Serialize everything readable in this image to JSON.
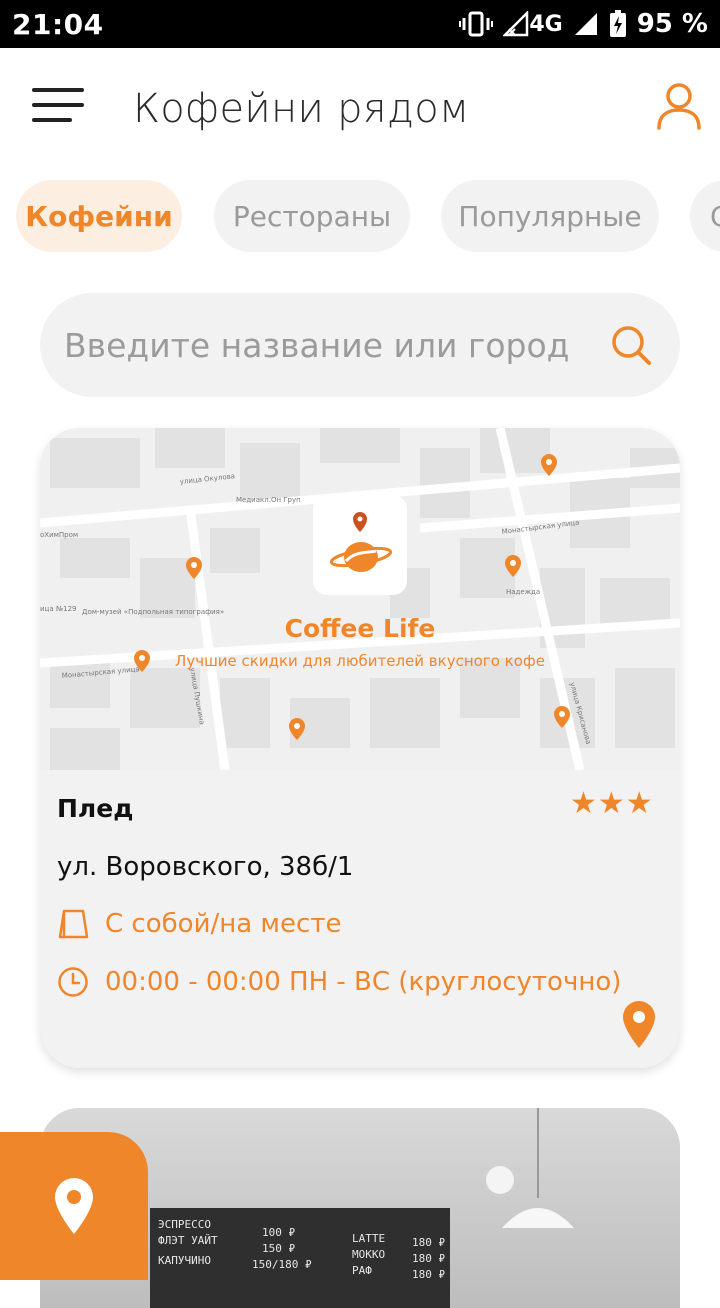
{
  "status_bar": {
    "time": "21:04",
    "network": "4G",
    "battery": "95 %"
  },
  "header": {
    "title": "Кофейни рядом",
    "menu_icon": "hamburger-icon",
    "profile_icon": "user-icon"
  },
  "categories": [
    {
      "label": "Кофейни",
      "active": true
    },
    {
      "label": "Рестораны",
      "active": false
    },
    {
      "label": "Популярные",
      "active": false
    },
    {
      "label": "С",
      "active": false
    }
  ],
  "search": {
    "placeholder": "Введите название или город",
    "value": ""
  },
  "cards": [
    {
      "brand_title": "Coffee Life",
      "brand_subtitle": "Лучшие скидки для любителей вкусного кофе",
      "map_labels": [
        "улица Окулова",
        "Медиакл.Он Груп",
        "оХимПром",
        "Монастырская улица",
        "Надежда",
        "Дом-музей «Подпольная типография»",
        "ица №129",
        "Монастырская улица",
        "улица Пушкина",
        "улица Крисанова"
      ],
      "name": "Плед",
      "rating_stars": 3,
      "rating_text": "★★★",
      "address": "ул. Воровского, 38б/1",
      "service": "С собой/на месте",
      "hours": "00:00 - 00:00 ПН - ВС (круглосуточно)"
    }
  ],
  "menu_board": {
    "rows_left": [
      {
        "item": "ЭСПРЕССО",
        "price": "100 ₽"
      },
      {
        "item": "ФЛЭТ УАЙТ",
        "price": "150 ₽"
      },
      {
        "item": "КАПУЧИНО",
        "price": "150/180 ₽"
      }
    ],
    "rows_right": [
      {
        "item": "LATTE",
        "price": "180 ₽"
      },
      {
        "item": "МОККО",
        "price": "180 ₽"
      },
      {
        "item": "РАФ",
        "price": "180 ₽"
      }
    ]
  },
  "colors": {
    "accent": "#f0862a",
    "accent_light": "#fdeee2",
    "chip_bg": "#f2f2f2",
    "text": "#111111"
  }
}
